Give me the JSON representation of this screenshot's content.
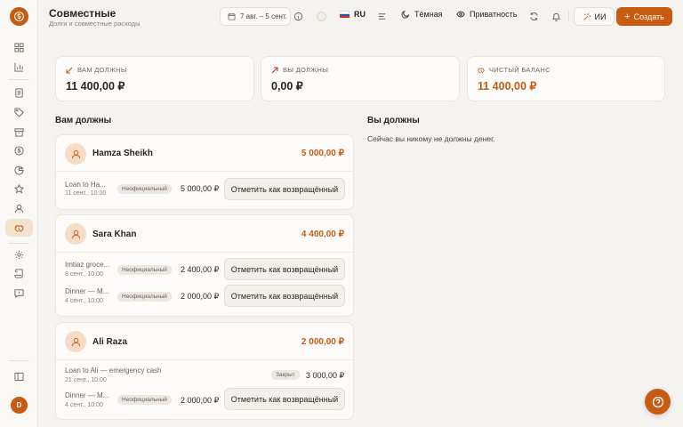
{
  "app": {
    "logo_icon": "coin-icon",
    "accent_color": "#c75b12"
  },
  "header": {
    "title": "Совместные",
    "subtitle": "Долги и совместные расходы",
    "date_range": "7 авг. – 5 сент.",
    "language": "RU",
    "theme_label": "Тёмная",
    "privacy_label": "Приватность",
    "ai_label": "ИИ",
    "create_label": "Создать"
  },
  "sidebar": {
    "items": [
      {
        "name": "dashboard",
        "icon": "grid-icon"
      },
      {
        "name": "analytics",
        "icon": "bar-chart-icon"
      },
      {
        "name": "documents",
        "icon": "document-icon"
      },
      {
        "name": "tags",
        "icon": "tag-icon"
      },
      {
        "name": "archive",
        "icon": "archive-icon"
      },
      {
        "name": "money",
        "icon": "dollar-circle-icon"
      },
      {
        "name": "reports",
        "icon": "pie-chart-icon"
      },
      {
        "name": "favorites",
        "icon": "star-icon"
      },
      {
        "name": "contacts",
        "icon": "user-icon"
      },
      {
        "name": "shared",
        "icon": "handshake-icon",
        "active": true
      },
      {
        "name": "settings",
        "icon": "gear-icon"
      },
      {
        "name": "scroll",
        "icon": "scroll-icon"
      },
      {
        "name": "feedback",
        "icon": "message-icon"
      }
    ],
    "collapse_icon": "sidebar-toggle-icon",
    "user_initial": "D"
  },
  "summary": {
    "owed_to_me": {
      "label": "ВАМ ДОЛЖНЫ",
      "value": "11 400,00 ₽"
    },
    "i_owe": {
      "label": "ВЫ ДОЛЖНЫ",
      "value": "0,00 ₽"
    },
    "net_balance": {
      "label": "ЧИСТЫЙ БАЛАНС",
      "value": "11 400,00 ₽"
    }
  },
  "owed_to_me_section": {
    "title": "Вам должны",
    "people": [
      {
        "name": "Hamza Sheikh",
        "total": "5 000,00 ₽",
        "rows": [
          {
            "title": "Loan to Ha...",
            "date": "11 сент., 10:00",
            "badge": "Неофициальный",
            "amount": "5 000,00 ₽",
            "action": "Отметить как возвращённый"
          }
        ]
      },
      {
        "name": "Sara Khan",
        "total": "4 400,00 ₽",
        "rows": [
          {
            "title": "Imtiaz groce...",
            "date": "8 сент., 10:00",
            "badge": "Неофициальный",
            "amount": "2 400,00 ₽",
            "action": "Отметить как возвращённый"
          },
          {
            "title": "Dinner — M...",
            "date": "4 сент., 10:00",
            "badge": "Неофициальный",
            "amount": "2 000,00 ₽",
            "action": "Отметить как возвращённый"
          }
        ]
      },
      {
        "name": "Ali Raza",
        "total": "2 000,00 ₽",
        "rows": [
          {
            "title": "Loan to Ali — emergency cash",
            "date": "21 сент., 10:00",
            "badge": "Закрыт",
            "amount": "3 000,00 ₽"
          },
          {
            "title": "Dinner — M...",
            "date": "4 сент., 10:00",
            "badge": "Неофициальный",
            "amount": "2 000,00 ₽",
            "action": "Отметить как возвращённый"
          }
        ]
      }
    ]
  },
  "i_owe_section": {
    "title": "Вы должны",
    "empty_message": "Сейчас вы никому не должны денег."
  }
}
